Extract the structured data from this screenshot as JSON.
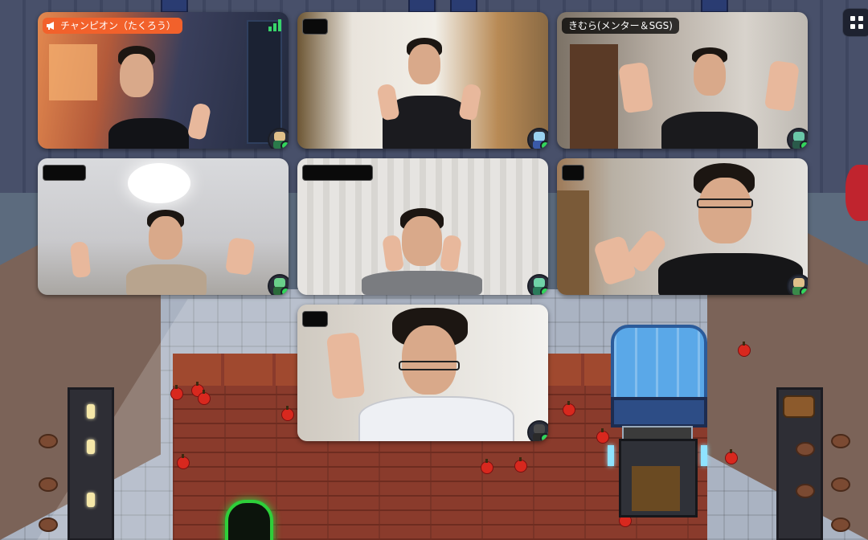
{
  "tiles": [
    {
      "id": "tile-1",
      "name": "チャンピオン（たくろう）",
      "label_type": "champion",
      "signal": true
    },
    {
      "id": "tile-2",
      "name": "",
      "label_type": "redacted"
    },
    {
      "id": "tile-3",
      "name": "きむら(メンター＆SGS)",
      "label_type": "name"
    },
    {
      "id": "tile-4",
      "name": "",
      "label_type": "redacted"
    },
    {
      "id": "tile-5",
      "name": "",
      "label_type": "redacted"
    },
    {
      "id": "tile-6",
      "name": "",
      "label_type": "redacted"
    },
    {
      "id": "tile-7",
      "name": "",
      "label_type": "redacted"
    }
  ],
  "colors": {
    "champion_badge": "#f2612b",
    "online_status": "#32d65b",
    "portal_glow": "#2ecf3a"
  },
  "icons": {
    "megaphone": "megaphone-icon",
    "signal": "signal-strength-icon",
    "grid": "grid-view-icon",
    "status": "online-status-dot"
  }
}
